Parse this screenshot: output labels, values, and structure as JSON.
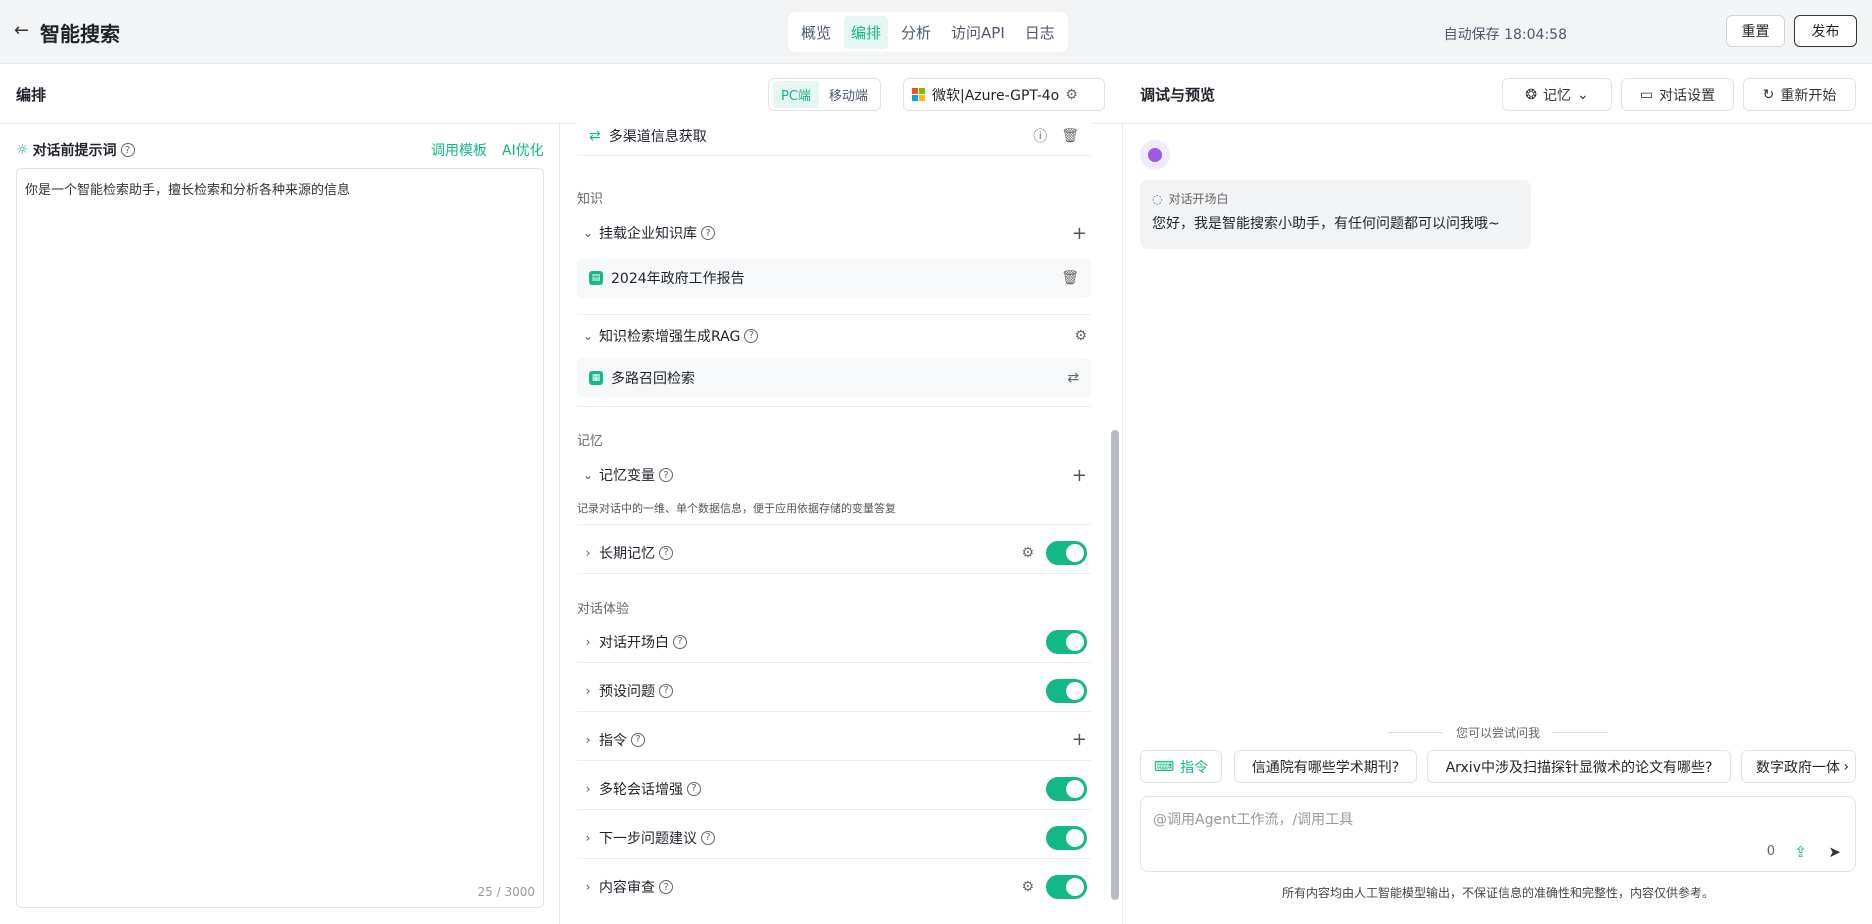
{
  "header": {
    "back_icon": "arrow-left-icon",
    "title": "智能搜索",
    "tabs": [
      "概览",
      "编排",
      "分析",
      "访问API",
      "日志"
    ],
    "active_tab": "编排",
    "autosave": "自动保存 18:04:58",
    "reset": "重置",
    "publish": "发布"
  },
  "editor": {
    "title": "编排",
    "platforms": [
      "PC端",
      "移动端"
    ],
    "model": "微软|Azure-GPT-4o",
    "prompt_label": "对话前提示词",
    "template_link": "调用模板",
    "ai_link": "AI优化",
    "prompt_text": "你是一个智能检索助手，擅长检索和分析各种来源的信息",
    "char_count": "25 / 3000"
  },
  "config": {
    "tool_item": "多渠道信息获取",
    "knowledge_title": "知识",
    "kb_label": "挂载企业知识库",
    "kb_item": "2024年政府工作报告",
    "rag_label": "知识检索增强生成RAG",
    "rag_item": "多路召回检索",
    "memory_title": "记忆",
    "memvar_label": "记忆变量",
    "memvar_desc": "记录对话中的一维、单个数据信息，便于应用依据存储的变量答复",
    "longmem_label": "长期记忆",
    "experience_title": "对话体验",
    "opening_label": "对话开场白",
    "preset_label": "预设问题",
    "command_label": "指令",
    "multiturn_label": "多轮会话增强",
    "nextq_label": "下一步问题建议",
    "review_label": "内容审查"
  },
  "preview": {
    "title": "调试与预览",
    "memory_btn": "记忆",
    "settings_btn": "对话设置",
    "restart_btn": "重新开始",
    "opening_tag": "对话开场白",
    "opening_msg": "您好，我是智能搜索小助手，有任何问题都可以问我哦~",
    "try_label": "您可以尝试问我",
    "command_chip": "指令",
    "suggestions": [
      "信通院有哪些学术期刊?",
      "Arxiv中涉及扫描探针显微术的论文有哪些?",
      "数字政府一体"
    ],
    "input_placeholder": "@调用Agent工作流，/调用工具",
    "input_count": "0",
    "disclaimer": "所有内容均由人工智能模型输出，不保证信息的准确性和完整性，内容仅供参考。"
  },
  "colors": {
    "accent": "#12b886",
    "brand_bg": "#e6f7ef"
  }
}
